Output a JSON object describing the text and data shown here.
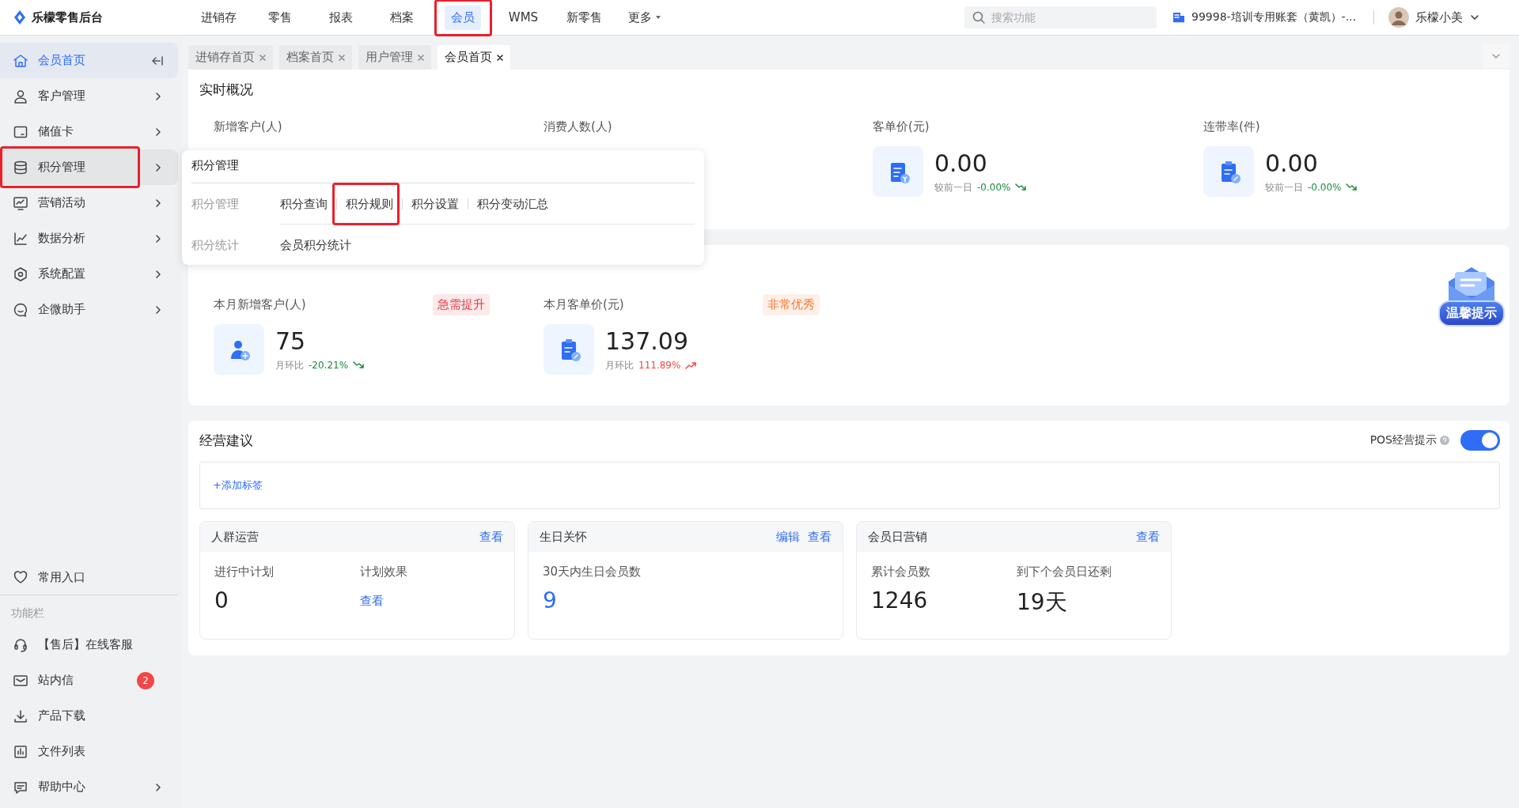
{
  "header": {
    "logo": "乐檬零售后台",
    "nav": [
      {
        "label": "进销存",
        "kind": "link",
        "selected": false,
        "annotated": false
      },
      {
        "label": "零售",
        "kind": "link",
        "selected": false,
        "annotated": false
      },
      {
        "label": "报表",
        "kind": "link",
        "selected": false,
        "annotated": false
      },
      {
        "label": "档案",
        "kind": "link",
        "selected": false,
        "annotated": false
      },
      {
        "label": "会员",
        "kind": "link",
        "selected": true,
        "annotated": true
      },
      {
        "label": "WMS",
        "kind": "link",
        "selected": false,
        "annotated": false
      },
      {
        "label": "新零售",
        "kind": "link",
        "selected": false,
        "annotated": false
      },
      {
        "label": "更多",
        "kind": "dropdown",
        "selected": false,
        "annotated": false
      }
    ],
    "search": {
      "placeholder": "搜索功能"
    },
    "account": "99998-培训专用账套（黄凯）-...",
    "user": "乐檬小美"
  },
  "sidebar": {
    "items": [
      {
        "label": "会员首页",
        "kind": "home",
        "selected": true,
        "hovered": false,
        "annotated": false
      },
      {
        "label": "客户管理",
        "kind": "group",
        "selected": false,
        "hovered": false,
        "annotated": false
      },
      {
        "label": "储值卡",
        "kind": "group",
        "selected": false,
        "hovered": false,
        "annotated": false
      },
      {
        "label": "积分管理",
        "kind": "group",
        "selected": false,
        "hovered": true,
        "annotated": true
      },
      {
        "label": "营销活动",
        "kind": "group",
        "selected": false,
        "hovered": false,
        "annotated": false
      },
      {
        "label": "数据分析",
        "kind": "group",
        "selected": false,
        "hovered": false,
        "annotated": false
      },
      {
        "label": "系统配置",
        "kind": "group",
        "selected": false,
        "hovered": false,
        "annotated": false
      },
      {
        "label": "企微助手",
        "kind": "group",
        "selected": false,
        "hovered": false,
        "annotated": false
      }
    ],
    "favorites": "常用入口",
    "section_label": "功能栏",
    "tools": [
      {
        "label": "【售后】在线客服",
        "kind": "link"
      },
      {
        "label": "站内信",
        "kind": "link",
        "badge": "2"
      },
      {
        "label": "产品下载",
        "kind": "link"
      },
      {
        "label": "文件列表",
        "kind": "link"
      },
      {
        "label": "帮助中心",
        "kind": "group"
      }
    ]
  },
  "tabs": [
    {
      "label": "进销存首页",
      "selected": false
    },
    {
      "label": "档案首页",
      "selected": false
    },
    {
      "label": "用户管理",
      "selected": false
    },
    {
      "label": "会员首页",
      "selected": true
    }
  ],
  "overview": {
    "title": "实时概况",
    "metrics": [
      {
        "label": "新增客户(人)"
      },
      {
        "label": "消费人数(人)"
      },
      {
        "label": "客单价(元)",
        "value": "0.00",
        "compare_label": "较前一日",
        "change": "-0.00%",
        "rising": false
      },
      {
        "label": "连带率(件)",
        "value": "0.00",
        "compare_label": "较前一日",
        "change": "-0.00%",
        "rising": false
      }
    ]
  },
  "diagnosis": {
    "metrics": [
      {
        "label": "本月新增客户(人)",
        "tag": {
          "text": "急需提升",
          "color": "#e5393f"
        },
        "value": "75",
        "compare_label": "月环比",
        "change": "-20.21%",
        "rising": false
      },
      {
        "label": "本月客单价(元)",
        "tag": {
          "text": "非常优秀",
          "color": "#f5772a"
        },
        "value": "137.09",
        "compare_label": "月环比",
        "change": "111.89%",
        "rising": true
      }
    ]
  },
  "notice_badge": "温馨提示",
  "advice": {
    "title": "经营建议",
    "toggle": {
      "label": "POS经营提示",
      "on": true
    },
    "add_tag": "+添加标签",
    "cards": [
      {
        "title": "人群运营",
        "actions": [
          "查看"
        ],
        "stats": [
          {
            "label": "进行中计划",
            "value": "0",
            "kind": "number"
          },
          {
            "label": "计划效果",
            "value": "查看",
            "kind": "link"
          }
        ]
      },
      {
        "title": "生日关怀",
        "actions": [
          "编辑",
          "查看"
        ],
        "stats": [
          {
            "label": "30天内生日会员数",
            "value": "9",
            "kind": "highlight"
          }
        ]
      },
      {
        "title": "会员日营销",
        "actions": [
          "查看"
        ],
        "stats": [
          {
            "label": "累计会员数",
            "value": "1246",
            "kind": "number"
          },
          {
            "label": "到下个会员日还剩",
            "value": "19天",
            "kind": "number"
          }
        ]
      }
    ]
  },
  "popup": {
    "title": "积分管理",
    "groups": [
      {
        "label": "积分管理",
        "links": [
          {
            "label": "积分查询",
            "annotated": false
          },
          {
            "label": "积分规则",
            "annotated": true
          },
          {
            "label": "积分设置",
            "annotated": false
          },
          {
            "label": "积分变动汇总",
            "annotated": false
          }
        ]
      },
      {
        "label": "积分统计",
        "links": [
          {
            "label": "会员积分统计",
            "annotated": false
          }
        ]
      }
    ]
  }
}
